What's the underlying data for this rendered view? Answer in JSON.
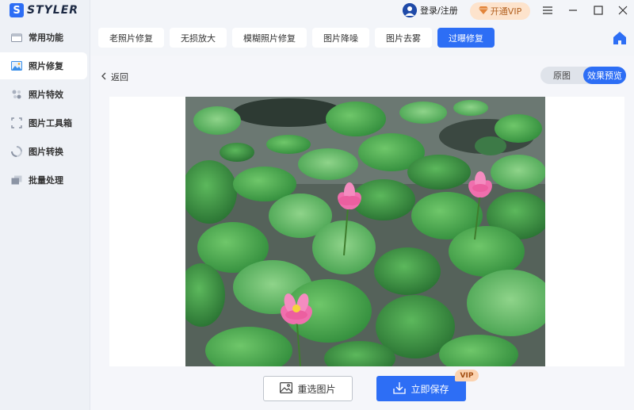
{
  "app": {
    "logo_letter": "S",
    "logo_text": "STYLER"
  },
  "sidebar": {
    "items": [
      {
        "label": "常用功能",
        "icon": "toolbox-icon"
      },
      {
        "label": "照片修复",
        "icon": "image-icon"
      },
      {
        "label": "照片特效",
        "icon": "sparkle-icon"
      },
      {
        "label": "图片工具箱",
        "icon": "crop-icon"
      },
      {
        "label": "图片转换",
        "icon": "convert-icon"
      },
      {
        "label": "批量处理",
        "icon": "layers-icon"
      }
    ],
    "active_index": 1
  },
  "topbar": {
    "login_label": "登录/注册",
    "vip_label": "开通VIP",
    "menu_icon": "menu-icon",
    "minimize_icon": "minimize-icon",
    "maximize_icon": "maximize-icon",
    "close_icon": "close-icon"
  },
  "tabs": [
    {
      "label": "老照片修复"
    },
    {
      "label": "无损放大"
    },
    {
      "label": "模糊照片修复"
    },
    {
      "label": "图片降噪"
    },
    {
      "label": "图片去雾"
    },
    {
      "label": "过曝修复"
    }
  ],
  "active_tab_index": 5,
  "main": {
    "back_label": "返回",
    "toggle_original": "原图",
    "toggle_preview": "效果预览",
    "reselect_label": "重选图片",
    "save_label": "立即保存",
    "vip_badge": "VIP"
  },
  "colors": {
    "accent": "#2d6ef5",
    "vip_bg": "#fde3cc",
    "sidebar_bg": "#eef1f6"
  }
}
